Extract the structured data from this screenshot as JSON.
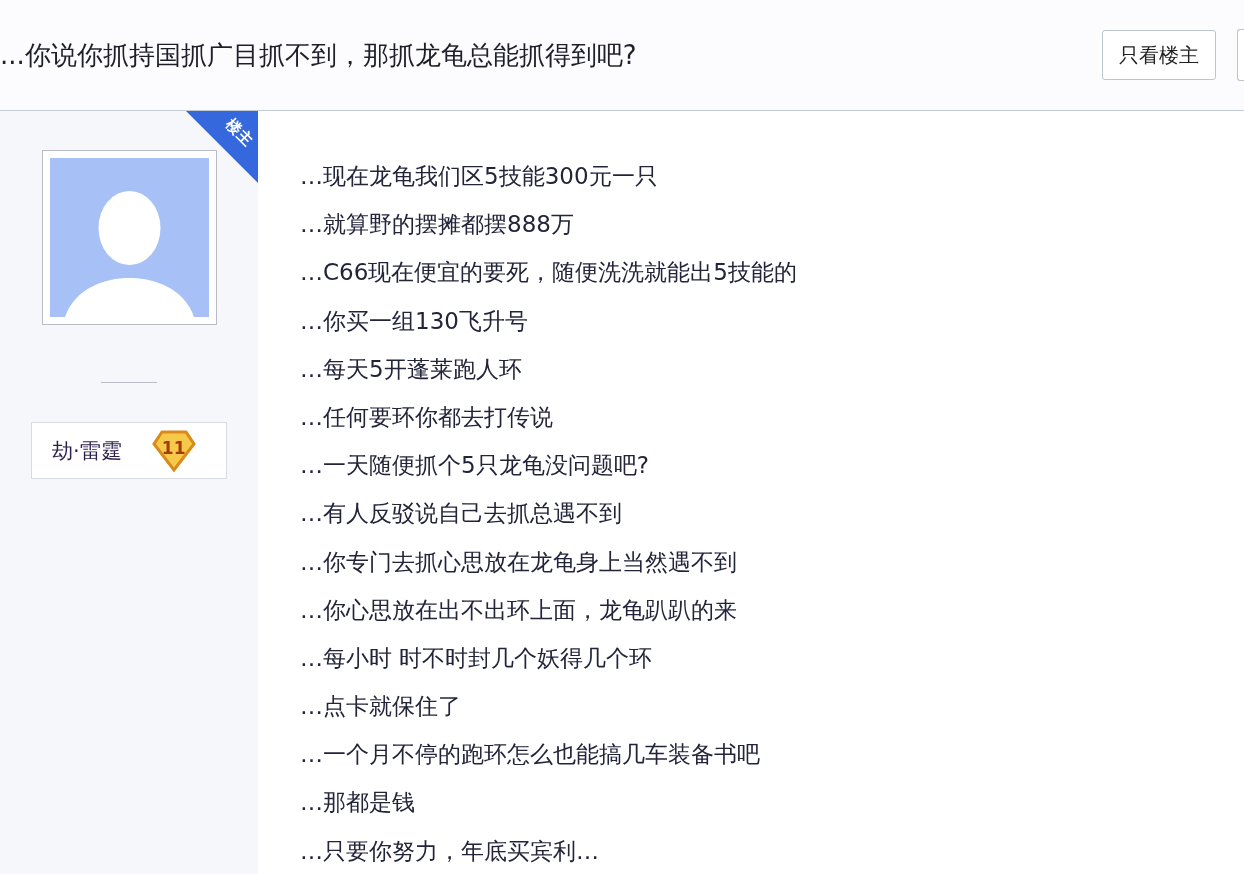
{
  "header": {
    "title": "...你说你抓持国抓广目抓不到，那抓龙龟总能抓得到吧?",
    "buttons": [
      "只看楼主"
    ]
  },
  "author": {
    "tag": "楼主",
    "name": "劫·雷霆",
    "level": "11"
  },
  "post": {
    "lines": [
      "…现在龙龟我们区5技能300元一只",
      "…就算野的摆摊都摆888万",
      "…C66现在便宜的要死，随便洗洗就能出5技能的",
      "…你买一组130飞升号",
      "…每天5开蓬莱跑人环",
      "…任何要环你都去打传说",
      "…一天随便抓个5只龙龟没问题吧?",
      "…有人反驳说自己去抓总遇不到",
      "…你专门去抓心思放在龙龟身上当然遇不到",
      "…你心思放在出不出环上面，龙龟趴趴的来",
      "…每小时 时不时封几个妖得几个环",
      "…点卡就保住了",
      "…一个月不停的跑环怎么也能搞几车装备书吧",
      "…那都是钱",
      "…只要你努力，年底买宾利…"
    ]
  }
}
